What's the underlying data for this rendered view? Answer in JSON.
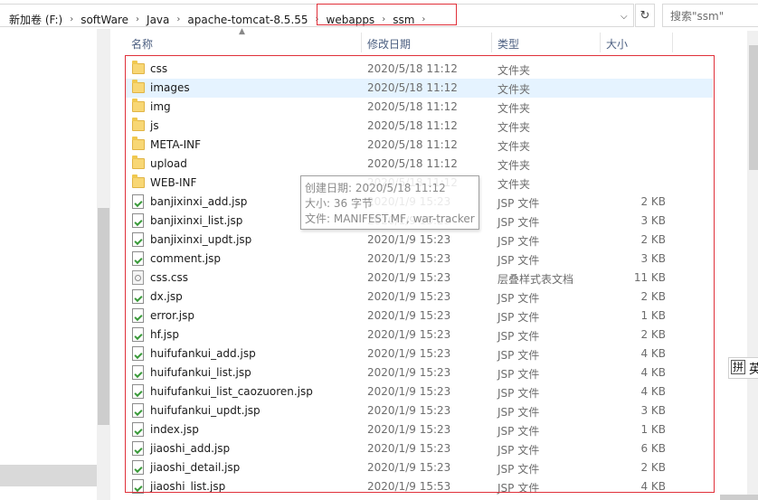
{
  "breadcrumbs": [
    "新加卷 (F:)",
    "softWare",
    "Java",
    "apache-tomcat-8.5.55",
    "webapps",
    "ssm"
  ],
  "search": {
    "placeholder": "搜索\"ssm\""
  },
  "columns": {
    "name": "名称",
    "date": "修改日期",
    "type": "类型",
    "size": "大小"
  },
  "files": [
    {
      "name": "css",
      "date": "2020/5/18 11:12",
      "type": "文件夹",
      "size": "",
      "kind": "folder"
    },
    {
      "name": "images",
      "date": "2020/5/18 11:12",
      "type": "文件夹",
      "size": "",
      "kind": "folder"
    },
    {
      "name": "img",
      "date": "2020/5/18 11:12",
      "type": "文件夹",
      "size": "",
      "kind": "folder"
    },
    {
      "name": "js",
      "date": "2020/5/18 11:12",
      "type": "文件夹",
      "size": "",
      "kind": "folder"
    },
    {
      "name": "META-INF",
      "date": "2020/5/18 11:12",
      "type": "文件夹",
      "size": "",
      "kind": "folder"
    },
    {
      "name": "upload",
      "date": "2020/5/18 11:12",
      "type": "文件夹",
      "size": "",
      "kind": "folder"
    },
    {
      "name": "WEB-INF",
      "date": "2020/5/18 11:12",
      "type": "文件夹",
      "size": "",
      "kind": "folder"
    },
    {
      "name": "banjixinxi_add.jsp",
      "date": "2020/1/9 15:23",
      "type": "JSP 文件",
      "size": "2 KB",
      "kind": "jsp"
    },
    {
      "name": "banjixinxi_list.jsp",
      "date": "2020/1/9 15:23",
      "type": "JSP 文件",
      "size": "3 KB",
      "kind": "jsp"
    },
    {
      "name": "banjixinxi_updt.jsp",
      "date": "2020/1/9 15:23",
      "type": "JSP 文件",
      "size": "2 KB",
      "kind": "jsp"
    },
    {
      "name": "comment.jsp",
      "date": "2020/1/9 15:23",
      "type": "JSP 文件",
      "size": "3 KB",
      "kind": "jsp"
    },
    {
      "name": "css.css",
      "date": "2020/1/9 15:23",
      "type": "层叠样式表文档",
      "size": "11 KB",
      "kind": "css"
    },
    {
      "name": "dx.jsp",
      "date": "2020/1/9 15:23",
      "type": "JSP 文件",
      "size": "2 KB",
      "kind": "jsp"
    },
    {
      "name": "error.jsp",
      "date": "2020/1/9 15:23",
      "type": "JSP 文件",
      "size": "1 KB",
      "kind": "jsp"
    },
    {
      "name": "hf.jsp",
      "date": "2020/1/9 15:23",
      "type": "JSP 文件",
      "size": "2 KB",
      "kind": "jsp"
    },
    {
      "name": "huifufankui_add.jsp",
      "date": "2020/1/9 15:23",
      "type": "JSP 文件",
      "size": "4 KB",
      "kind": "jsp"
    },
    {
      "name": "huifufankui_list.jsp",
      "date": "2020/1/9 15:23",
      "type": "JSP 文件",
      "size": "4 KB",
      "kind": "jsp"
    },
    {
      "name": "huifufankui_list_caozuoren.jsp",
      "date": "2020/1/9 15:23",
      "type": "JSP 文件",
      "size": "4 KB",
      "kind": "jsp"
    },
    {
      "name": "huifufankui_updt.jsp",
      "date": "2020/1/9 15:23",
      "type": "JSP 文件",
      "size": "3 KB",
      "kind": "jsp"
    },
    {
      "name": "index.jsp",
      "date": "2020/1/9 15:23",
      "type": "JSP 文件",
      "size": "1 KB",
      "kind": "jsp"
    },
    {
      "name": "jiaoshi_add.jsp",
      "date": "2020/1/9 15:23",
      "type": "JSP 文件",
      "size": "6 KB",
      "kind": "jsp"
    },
    {
      "name": "jiaoshi_detail.jsp",
      "date": "2020/1/9 15:23",
      "type": "JSP 文件",
      "size": "2 KB",
      "kind": "jsp"
    },
    {
      "name": "jiaoshi_list.jsp",
      "date": "2020/1/9 15:53",
      "type": "JSP 文件",
      "size": "4 KB",
      "kind": "jsp"
    }
  ],
  "selected_index": 1,
  "tooltip": {
    "line1": "创建日期: 2020/5/18 11:12",
    "line2": "大小: 36 字节",
    "line3": "文件: MANIFEST.MF, war-tracker"
  },
  "ime": {
    "key": "拼",
    "mode": "英"
  },
  "colors": {
    "highlight": "#e0303a",
    "selection": "#e5f3ff",
    "header_text": "#4d6082"
  }
}
